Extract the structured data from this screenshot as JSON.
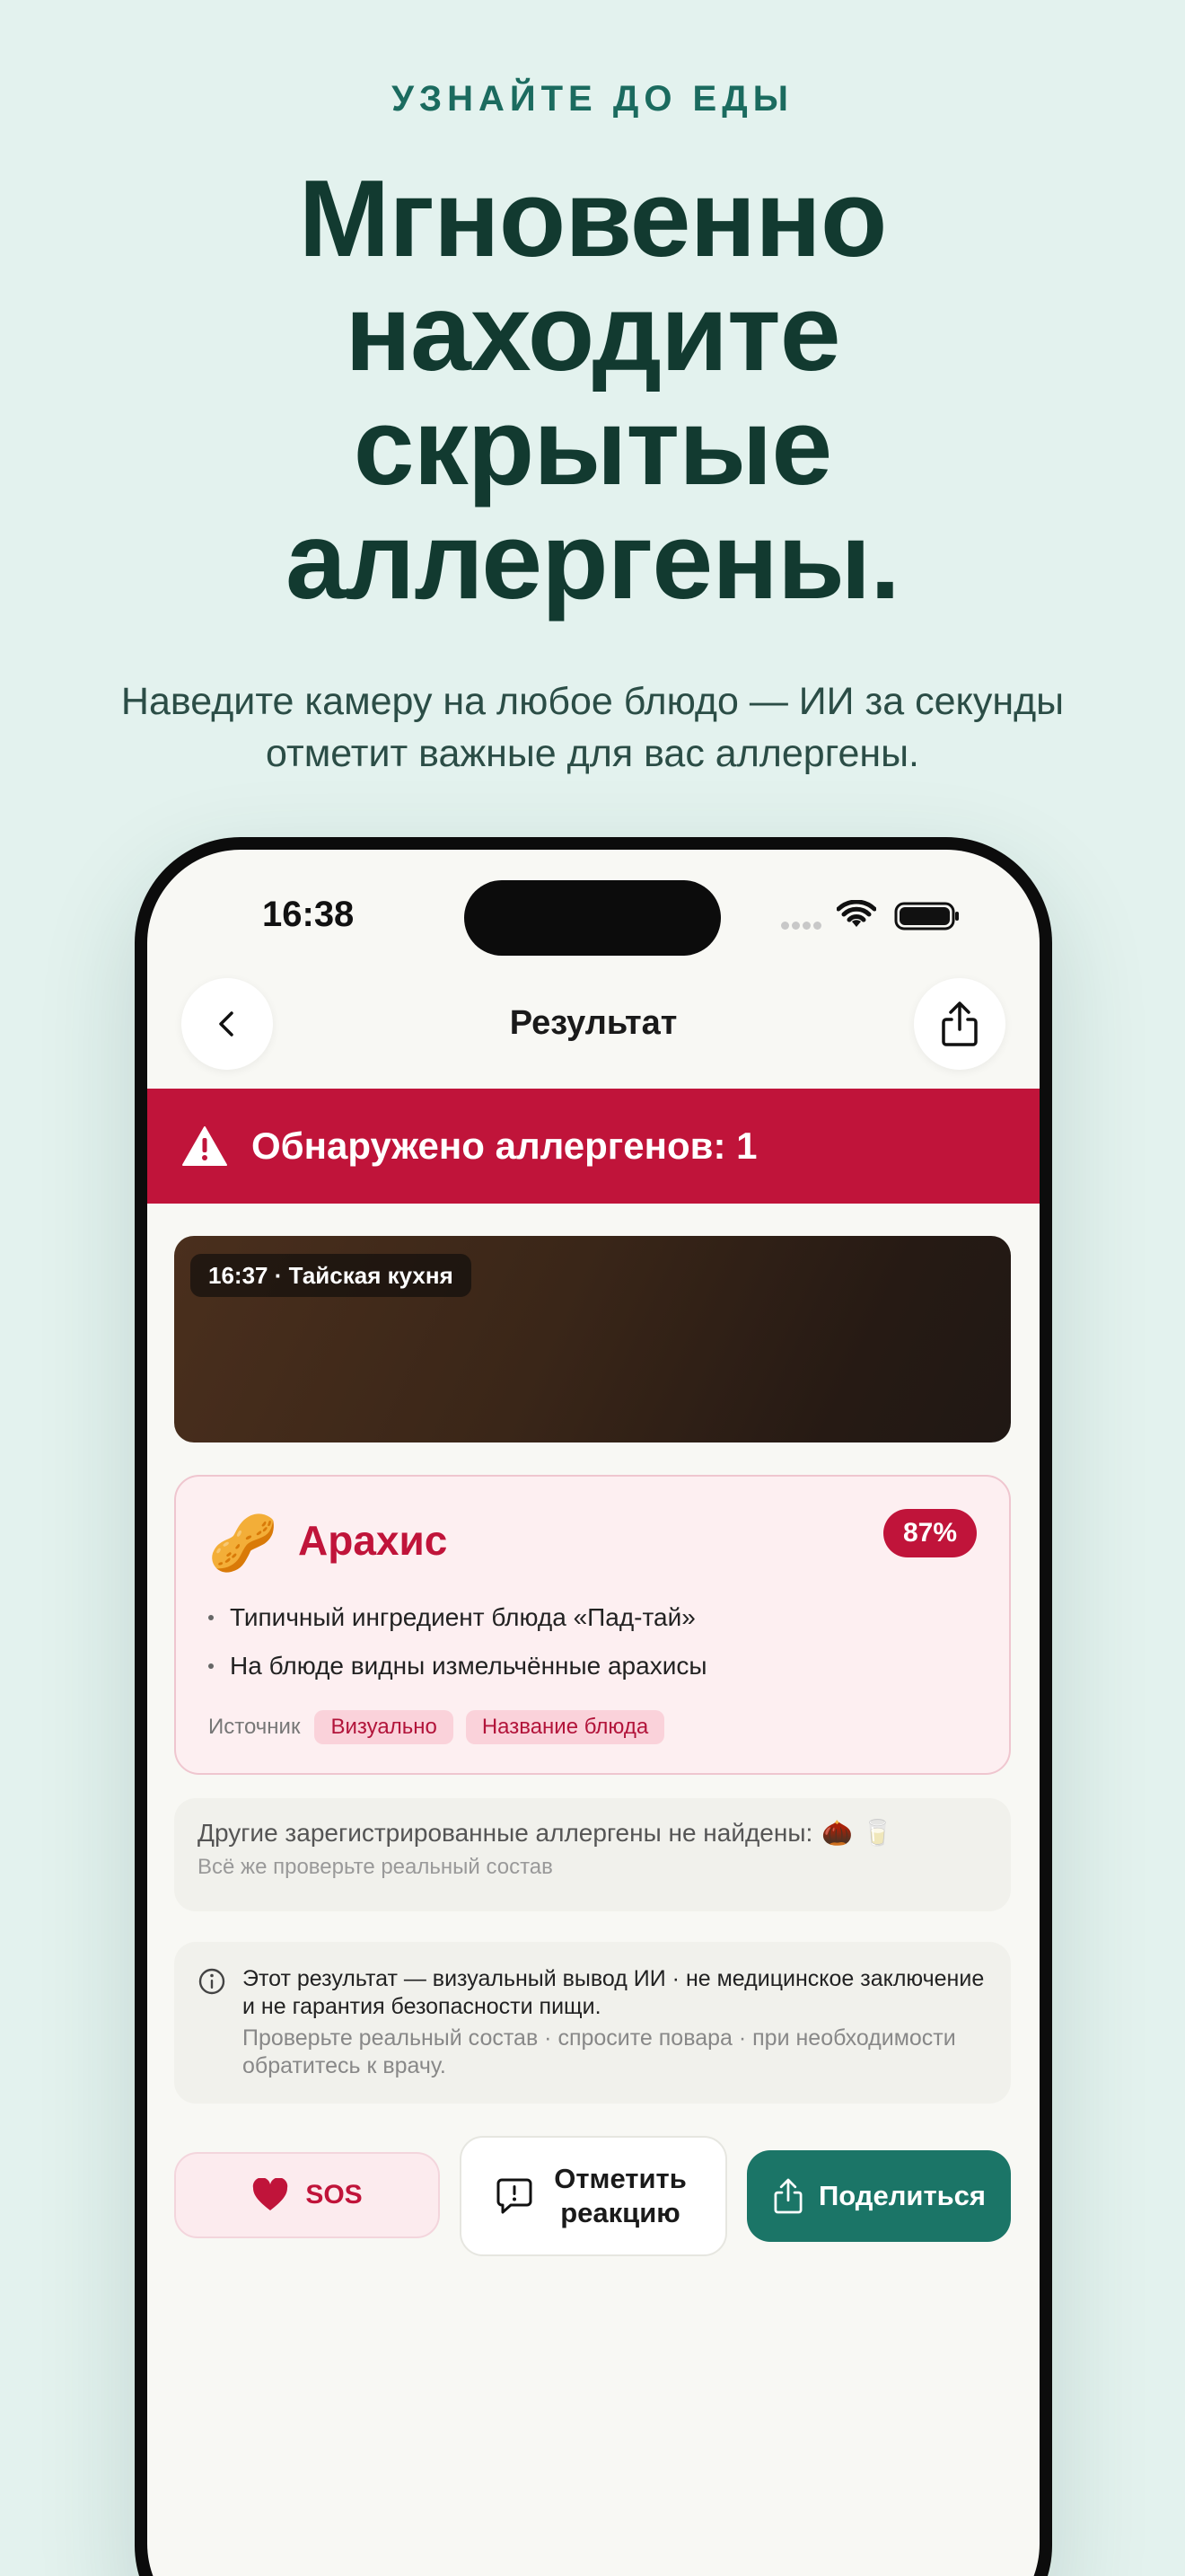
{
  "hero": {
    "kicker": "УЗНАЙТЕ ДО ЕДЫ",
    "headline": "Мгновенно находите скрытые аллергены.",
    "subtitle": "Наведите камеру на любое блюдо — ИИ за секунды отметит важные для вас аллергены."
  },
  "status_bar": {
    "time": "16:38"
  },
  "nav": {
    "title": "Результат",
    "back_icon": "chevron-left-icon",
    "share_icon": "share-icon"
  },
  "alert": {
    "text": "Обнаружено аллергенов: 1",
    "icon": "warning-triangle-icon"
  },
  "photo": {
    "tag": "16:37 · Тайская кухня"
  },
  "allergen_card": {
    "emoji": "🥜",
    "name": "Арахис",
    "confidence": "87%",
    "reasons": [
      "Типичный ингредиент блюда «Пад-тай»",
      "На блюде видны измельчённые арахисы"
    ],
    "source_label": "Источник",
    "sources": [
      "Визуально",
      "Название блюда"
    ]
  },
  "others": {
    "line1": "Другие зарегистрированные аллергены не найдены:",
    "icons": [
      "🌰",
      "🥛"
    ],
    "line2": "Всё же проверьте реальный состав"
  },
  "disclaimer": {
    "line1": "Этот результат — визуальный вывод ИИ · не медицинское заключение и не гарантия безопасности пищи.",
    "line2": "Проверьте реальный состав · спросите повара · при необходимости обратитесь к врачу."
  },
  "actions": {
    "sos": "SOS",
    "react": "Отметить реакцию",
    "share": "Поделиться"
  },
  "colors": {
    "accent_red": "#c0143a",
    "accent_green": "#1b7567",
    "background": "#e3f2ee"
  }
}
